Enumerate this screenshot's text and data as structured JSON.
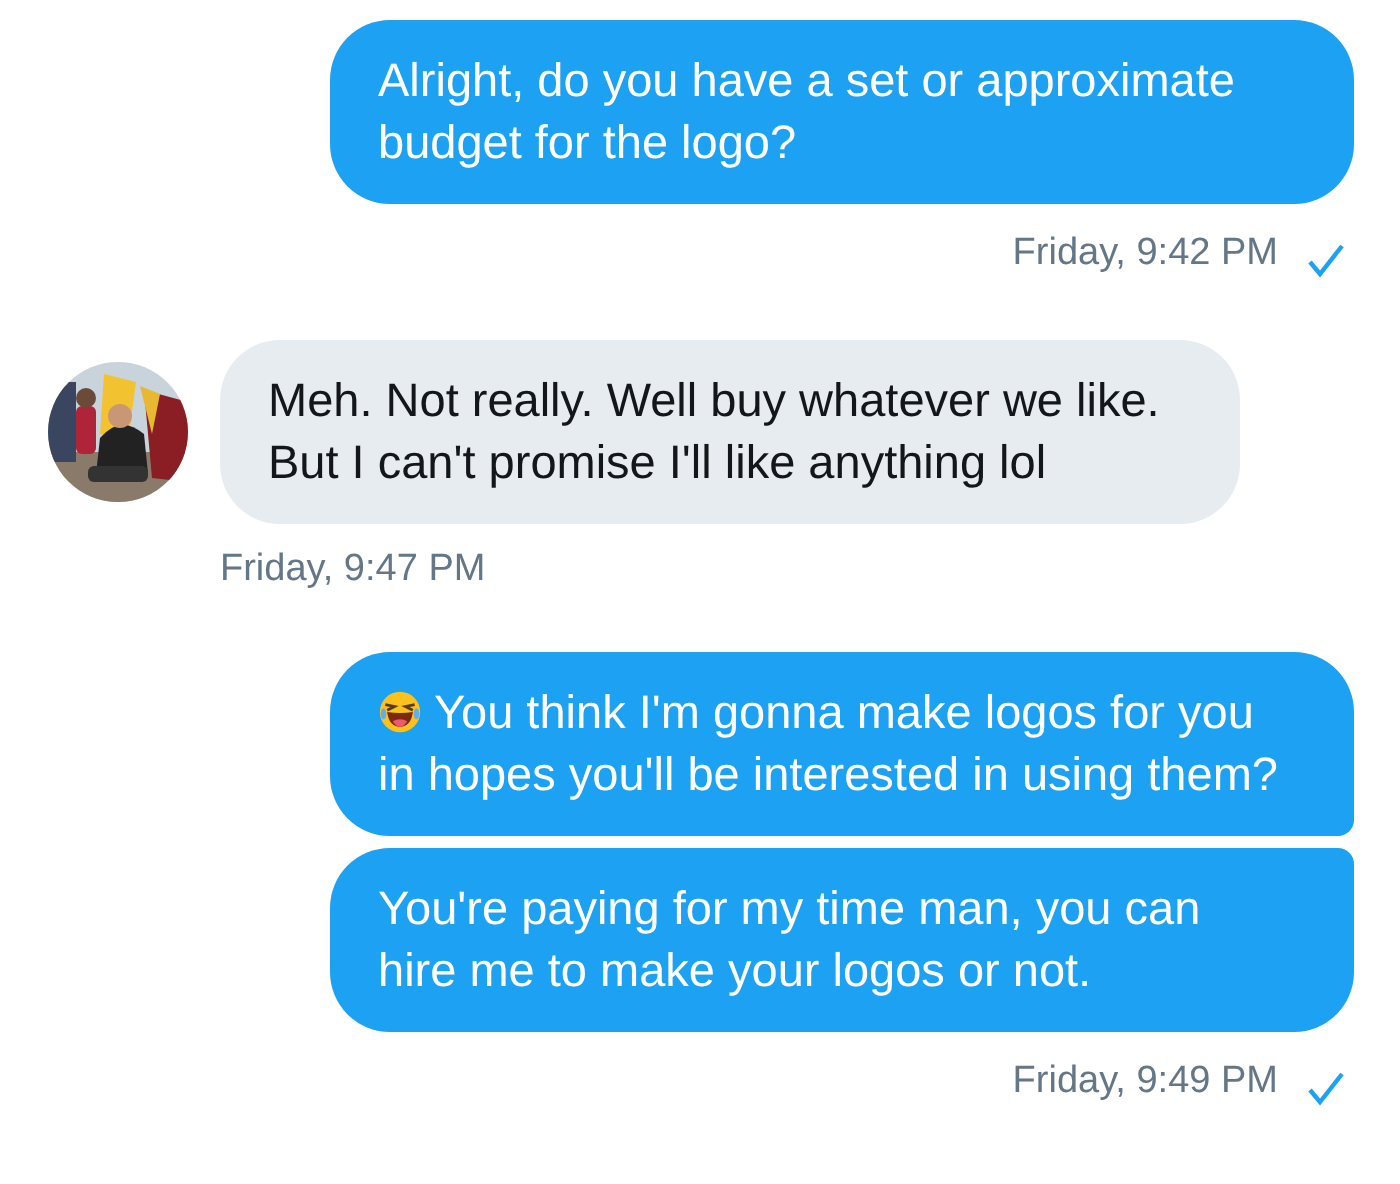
{
  "messages": [
    {
      "kind": "sent",
      "emoji": false,
      "text": "Alright, do you have a set or approximate budget for the logo?",
      "time": "Friday, 9:42 PM",
      "read": true
    },
    {
      "kind": "received",
      "text": "Meh. Not really. Well buy whatever we like. But I can't promise I'll like anything lol",
      "time": "Friday, 9:47 PM"
    },
    {
      "kind": "sent",
      "emoji": true,
      "text": "You think I'm gonna make logos for you in hopes you'll be interested in using them?"
    },
    {
      "kind": "sent",
      "emoji": false,
      "text": "You're paying for my time man, you can hire me to make your logos or not.",
      "time": "Friday, 9:49 PM",
      "read": true
    }
  ]
}
